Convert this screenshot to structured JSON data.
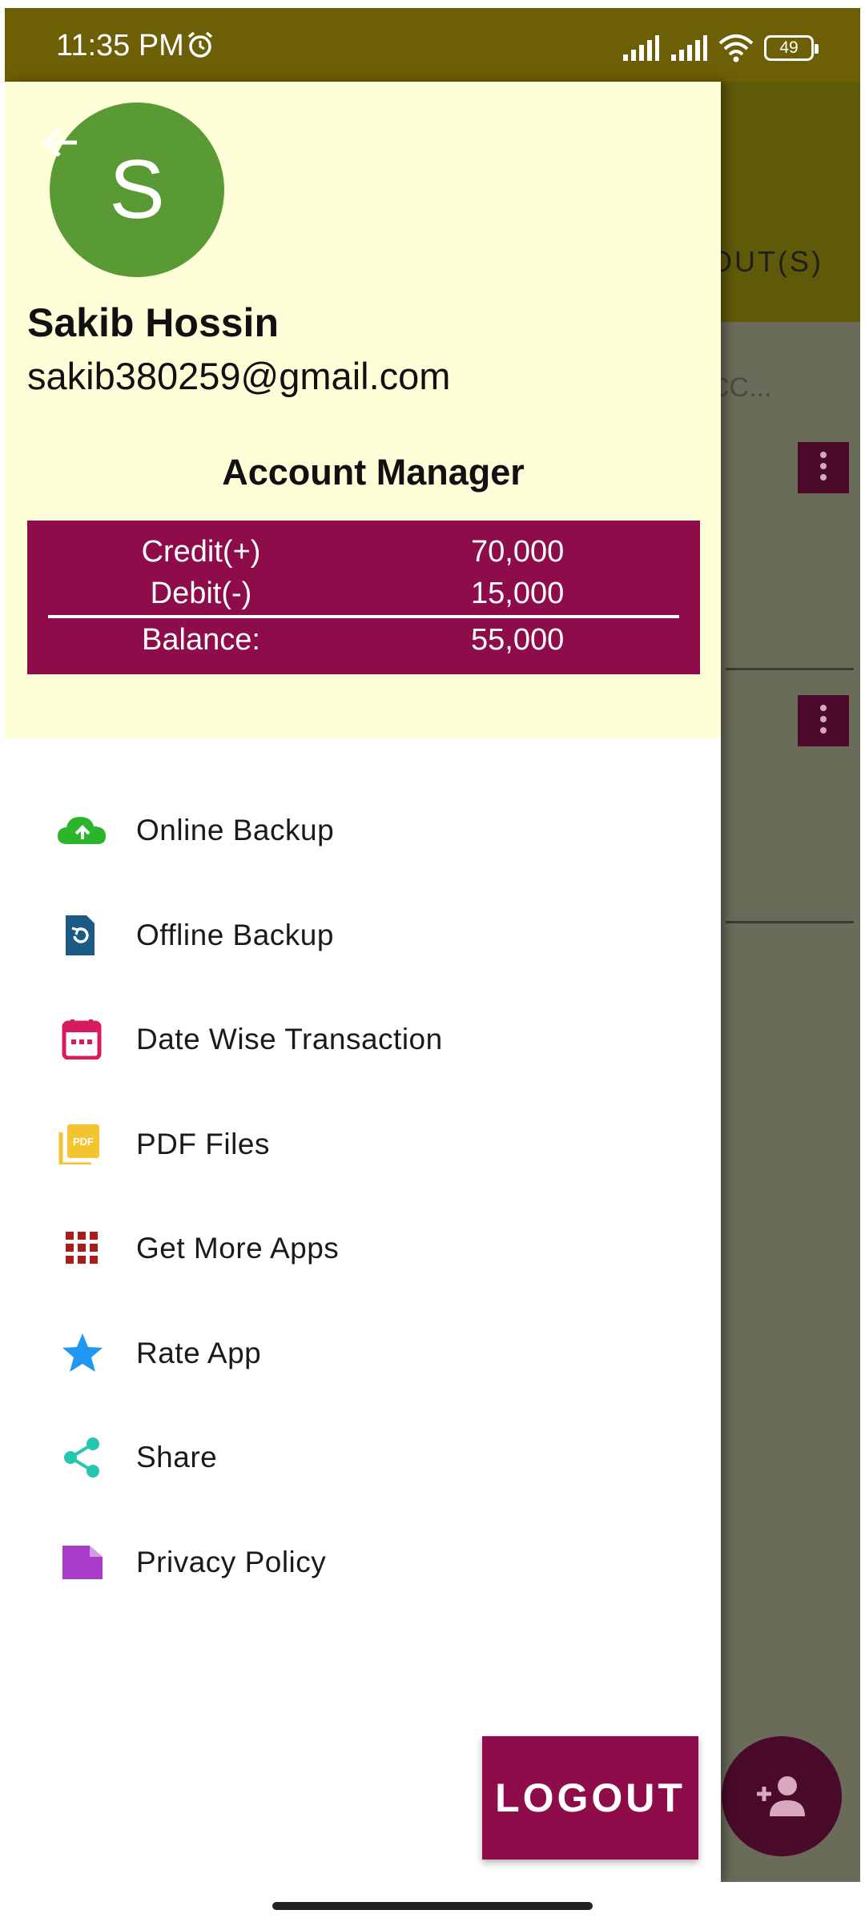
{
  "status_bar": {
    "time": "11:35 PM",
    "battery": "49",
    "icons": [
      "alarm-icon",
      "signal-icon",
      "signal-icon",
      "wifi-icon",
      "battery-icon"
    ]
  },
  "background": {
    "tab_text": "OUT(S)",
    "search_text": "CC...",
    "fab_icon": "add-person-icon"
  },
  "drawer": {
    "avatar_letter": "S",
    "user_name": "Sakib Hossin",
    "user_email": "sakib380259@gmail.com",
    "account_manager_title": "Account Manager",
    "ledger": {
      "credit_label": "Credit(+)",
      "credit_value": "70,000",
      "debit_label": "Debit(-)",
      "debit_value": "15,000",
      "balance_label": "Balance:",
      "balance_value": "55,000"
    },
    "menu": [
      {
        "label": "Online Backup",
        "icon": "cloud-upload-icon",
        "color": "#2bb52b"
      },
      {
        "label": "Offline Backup",
        "icon": "restore-file-icon",
        "color": "#1c5a86"
      },
      {
        "label": "Date Wise Transaction",
        "icon": "calendar-icon",
        "color": "#d81b60"
      },
      {
        "label": "PDF Files",
        "icon": "pdf-icon",
        "color": "#f4c430"
      },
      {
        "label": "Get More Apps",
        "icon": "apps-grid-icon",
        "color": "#a51d1d"
      },
      {
        "label": "Rate App",
        "icon": "star-icon",
        "color": "#2196f3"
      },
      {
        "label": "Share",
        "icon": "share-icon",
        "color": "#26c6b0"
      },
      {
        "label": "Privacy Policy",
        "icon": "document-icon",
        "color": "#a73cc8"
      }
    ],
    "logout_label": "LOGOUT"
  },
  "colors": {
    "accent": "#8e0c4a",
    "header_bg": "#fefed8",
    "status_bar": "#6d5f06"
  }
}
